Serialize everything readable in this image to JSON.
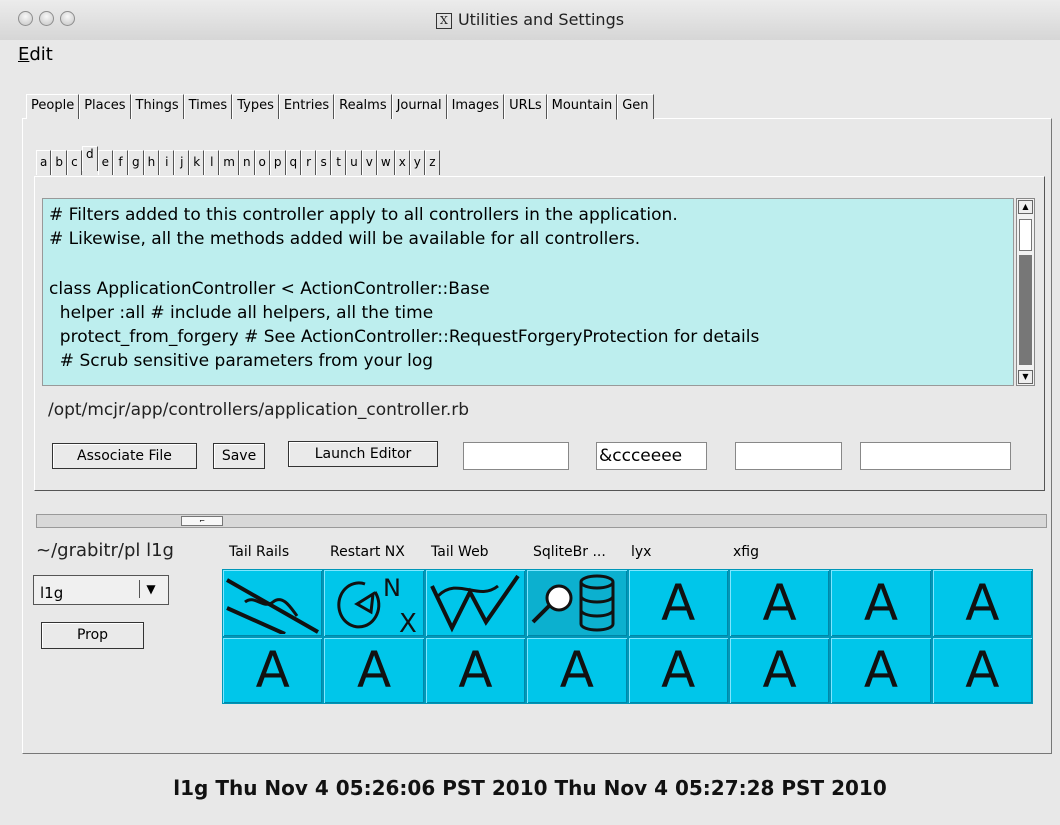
{
  "window": {
    "title": "Utilities and Settings",
    "title_icon": "x11-icon"
  },
  "menu": {
    "edit": "Edit"
  },
  "outer_tabs": [
    "People",
    "Places",
    "Things",
    "Times",
    "Types",
    "Entries",
    "Realms",
    "Journal",
    "Images",
    "URLs",
    "Mountain",
    "Gen"
  ],
  "outer_active": "Mountain",
  "alpha_tabs": [
    "a",
    "b",
    "c",
    "d",
    "e",
    "f",
    "g",
    "h",
    "i",
    "j",
    "k",
    "l",
    "m",
    "n",
    "o",
    "p",
    "q",
    "r",
    "s",
    "t",
    "u",
    "v",
    "w",
    "x",
    "y",
    "z"
  ],
  "alpha_active": "d",
  "code_lines": [
    "# Filters added to this controller apply to all controllers in the application.",
    "# Likewise, all the methods added will be available for all controllers.",
    "",
    "class ApplicationController < ActionController::Base",
    "  helper :all # include all helpers, all the time",
    "  protect_from_forgery # See ActionController::RequestForgeryProtection for details",
    "  # Scrub sensitive parameters from your log"
  ],
  "file_path": "/opt/mcjr/app/controllers/application_controller.rb",
  "buttons": {
    "associate": "Associate File",
    "save": "Save",
    "launch": "Launch Editor",
    "prop": "Prop"
  },
  "fields": [
    "",
    "&ccceeee",
    "",
    ""
  ],
  "home_path": "~/grabitr/pl l1g",
  "select_value": "l1g",
  "launch_labels": [
    "Tail Rails",
    "Restart NX",
    "Tail Web",
    "SqliteBr ...",
    "lyx",
    "xfig"
  ],
  "grid": {
    "row1": [
      {
        "icon": "rails-log-icon"
      },
      {
        "icon": "restart-nx-icon"
      },
      {
        "icon": "web-log-icon"
      },
      {
        "icon": "sqlite-browser-icon"
      },
      {
        "label": "A"
      },
      {
        "label": "A"
      },
      {
        "label": "A"
      },
      {
        "label": "A"
      }
    ],
    "row2": [
      "A",
      "A",
      "A",
      "A",
      "A",
      "A",
      "A",
      "A"
    ]
  },
  "status_text": "l1g Thu Nov 4 05:26:06 PST 2010 Thu Nov 4 05:27:28 PST 2010",
  "colors": {
    "code_bg": "#bdeeee",
    "tile_bg": "#00c6ea"
  }
}
